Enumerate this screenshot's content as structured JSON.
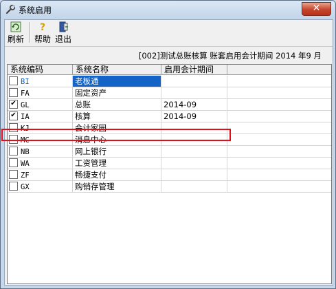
{
  "window": {
    "title": "系统启用",
    "close_label": "✕"
  },
  "toolbar": {
    "refresh_label": "刷新",
    "help_label": "帮助",
    "exit_label": "退出"
  },
  "info": {
    "text": "[002]测试总账核算 账套启用会计期间 2014 年9 月"
  },
  "table": {
    "headers": [
      "系统编码",
      "系统名称",
      "启用会计期间"
    ],
    "rows": [
      {
        "code": "BI",
        "name": "老板通",
        "period": "",
        "checked": false
      },
      {
        "code": "FA",
        "name": "固定资产",
        "period": "",
        "checked": false
      },
      {
        "code": "GL",
        "name": "总账",
        "period": "2014-09",
        "checked": true
      },
      {
        "code": "IA",
        "name": "核算",
        "period": "2014-09",
        "checked": true
      },
      {
        "code": "KJ",
        "name": "会计家园",
        "period": "",
        "checked": false
      },
      {
        "code": "MC",
        "name": "消息中心",
        "period": "",
        "checked": false
      },
      {
        "code": "NB",
        "name": "网上银行",
        "period": "",
        "checked": false
      },
      {
        "code": "WA",
        "name": "工资管理",
        "period": "",
        "checked": false
      },
      {
        "code": "ZF",
        "name": "畅捷支付",
        "period": "",
        "checked": false
      },
      {
        "code": "GX",
        "name": "购销存管理",
        "period": "",
        "checked": false
      }
    ]
  },
  "colors": {
    "selection": "#1464c8",
    "highlight_box": "#e0101a"
  }
}
